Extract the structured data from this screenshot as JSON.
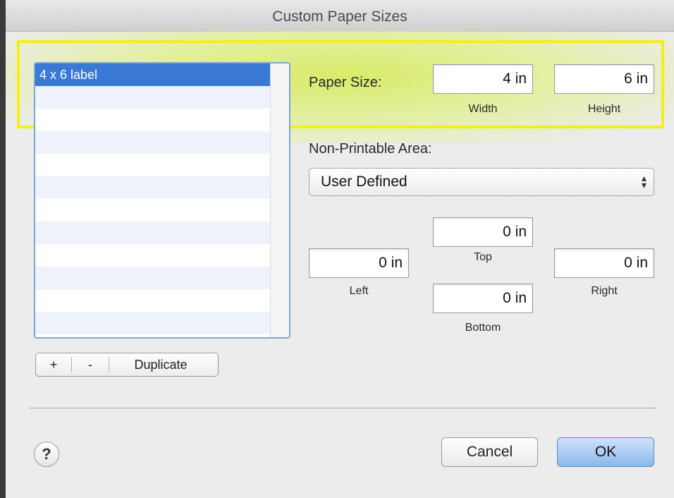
{
  "window": {
    "title": "Custom Paper Sizes"
  },
  "list": {
    "items": [
      "4 x 6 label"
    ],
    "empty_rows": 11,
    "buttons": {
      "add": "+",
      "remove": "-",
      "duplicate": "Duplicate"
    }
  },
  "paper_size": {
    "label": "Paper Size:",
    "width": {
      "value": "4  in",
      "caption": "Width"
    },
    "height": {
      "value": "6  in",
      "caption": "Height"
    }
  },
  "non_printable": {
    "label": "Non-Printable Area:",
    "selected": "User Defined",
    "top": {
      "value": "0  in",
      "caption": "Top"
    },
    "left": {
      "value": "0  in",
      "caption": "Left"
    },
    "right": {
      "value": "0  in",
      "caption": "Right"
    },
    "bottom": {
      "value": "0  in",
      "caption": "Bottom"
    }
  },
  "footer": {
    "help": "?",
    "cancel": "Cancel",
    "ok": "OK"
  },
  "colors": {
    "selection": "#3b79d6",
    "highlight_border": "#f5ee1c",
    "ok_button": "#8bb8ec"
  },
  "icons": {
    "help": "question-mark-icon",
    "popup": "up-down-arrows-icon"
  }
}
